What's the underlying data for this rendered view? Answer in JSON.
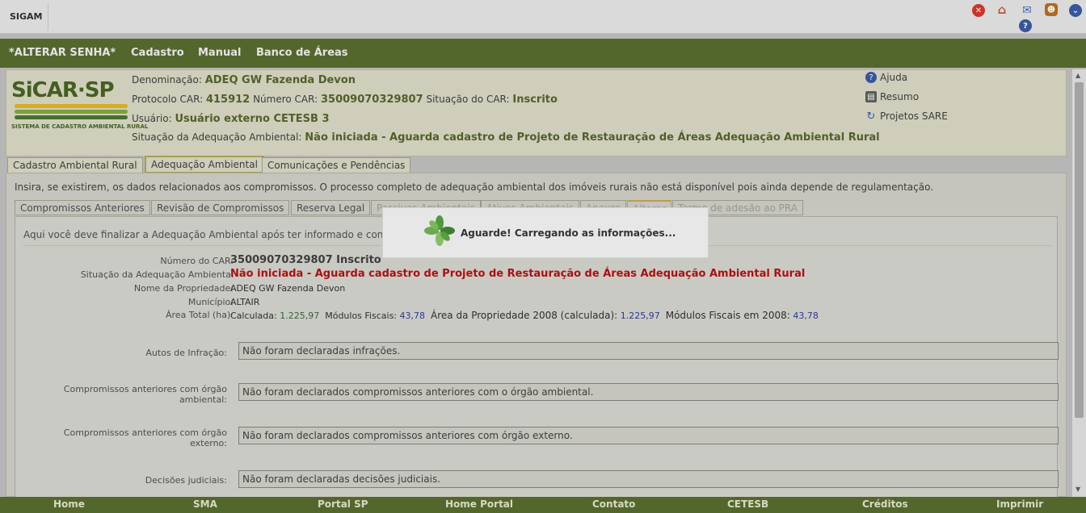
{
  "app": {
    "title": "SIGAM"
  },
  "top_icons": [
    {
      "icon": "close-icon",
      "color": "#d42a1f"
    },
    {
      "icon": "home-icon",
      "color": "#c84a2a"
    },
    {
      "icon": "mail-icon",
      "color": "#3a66b8"
    },
    {
      "icon": "user-icon",
      "color": "#b8660f"
    },
    {
      "icon": "chevron-down-icon",
      "color": "#2d4fa0"
    },
    {
      "icon": "help-icon",
      "color": "#2d4fa0"
    }
  ],
  "nav": {
    "items": [
      {
        "label": "*ALTERAR SENHA*"
      },
      {
        "label": "Cadastro"
      },
      {
        "label": "Manual"
      },
      {
        "label": "Banco de Áreas"
      }
    ]
  },
  "logo": {
    "text": "SiCAR·SP",
    "subtitle": "SISTEMA DE CADASTRO AMBIENTAL RURAL"
  },
  "header": {
    "denominacao_label": "Denominação:",
    "denominacao": "ADEQ GW Fazenda Devon",
    "protocolo_label": "Protocolo CAR:",
    "protocolo": "415912",
    "numero_label": "Número CAR:",
    "numero": "35009070329807",
    "situacao_label": "Situação do CAR:",
    "situacao": "Inscrito",
    "usuario_label": "Usuário:",
    "usuario": "Usuário externo CETESB 3",
    "adequacao_label": "Situação da Adequação Ambiental:",
    "adequacao": "Não iniciada - Aguarda cadastro de Projeto de Restauração de Áreas Adequação Ambiental Rural"
  },
  "side_links": [
    {
      "label": "Ajuda",
      "icon": "help-icon"
    },
    {
      "label": "Resumo",
      "icon": "document-icon"
    },
    {
      "label": "Projetos SARE",
      "icon": "refresh-icon"
    }
  ],
  "tabs": [
    {
      "label": "Cadastro Ambiental Rural"
    },
    {
      "label": "Adequação Ambiental"
    },
    {
      "label": "Comunicações e Pendências"
    }
  ],
  "content": {
    "intro": "Insira, se existirem, os dados relacionados aos compromissos. O processo completo de adequação ambiental dos imóveis rurais não está disponível pois ainda depende de regulamentação.",
    "subtabs": [
      {
        "label": "Compromissos Anteriores"
      },
      {
        "label": "Revisão de Compromissos"
      },
      {
        "label": "Reserva Legal"
      },
      {
        "label": "Passivos Ambientais"
      },
      {
        "label": "Ativos Ambientais"
      },
      {
        "label": "Anexos"
      },
      {
        "label": "Alterar"
      },
      {
        "label": "Termo de adesão ao PRA"
      }
    ],
    "finalize": "Aqui você deve finalizar a Adequação Ambiental após ter informado e conferido todos os dados necessários.",
    "fields": {
      "numero_car_label": "Número do CAR:",
      "numero_car": "35009070329807 Inscrito",
      "adequacao_label": "Situação da Adequação Ambiental",
      "adequacao": "Não iniciada - Aguarda cadastro de Projeto de Restauração de Áreas Adequação Ambiental Rural",
      "nome_label": "Nome da Propriedade:",
      "nome": "ADEQ GW Fazenda Devon",
      "municipio_label": "Município:",
      "municipio": "ALTAIR",
      "area_label": "Área Total (ha):",
      "calculada_label": "Calculada:",
      "calculada": "1.225,97",
      "modulos_label": "Módulos Fiscais:",
      "modulos": "43,78",
      "area2008_label": "Área da Propriedade 2008 (calculada):",
      "area2008": "1.225,97",
      "modulos2008_label": "Módulos Fiscais em 2008:",
      "modulos2008": "43,78"
    },
    "declarations": [
      {
        "label": "Autos de Infração:",
        "value": "Não foram declaradas infrações."
      },
      {
        "label": "Compromissos anteriores com órgão ambiental:",
        "value": "Não foram declarados compromissos anteriores com o órgão ambiental."
      },
      {
        "label": "Compromissos anteriores com órgão externo:",
        "value": "Não foram declarados compromissos anteriores com órgão externo."
      },
      {
        "label": "Decisões judiciais:",
        "value": "Não foram declaradas decisões judiciais."
      }
    ]
  },
  "loading": {
    "text": "Aguarde! Carregando as informações..."
  },
  "footer": {
    "items": [
      {
        "label": "Home"
      },
      {
        "label": "SMA"
      },
      {
        "label": "Portal SP"
      },
      {
        "label": "Home Portal"
      },
      {
        "label": "Contato"
      },
      {
        "label": "CETESB"
      },
      {
        "label": "Créditos"
      },
      {
        "label": "Imprimir"
      }
    ]
  }
}
